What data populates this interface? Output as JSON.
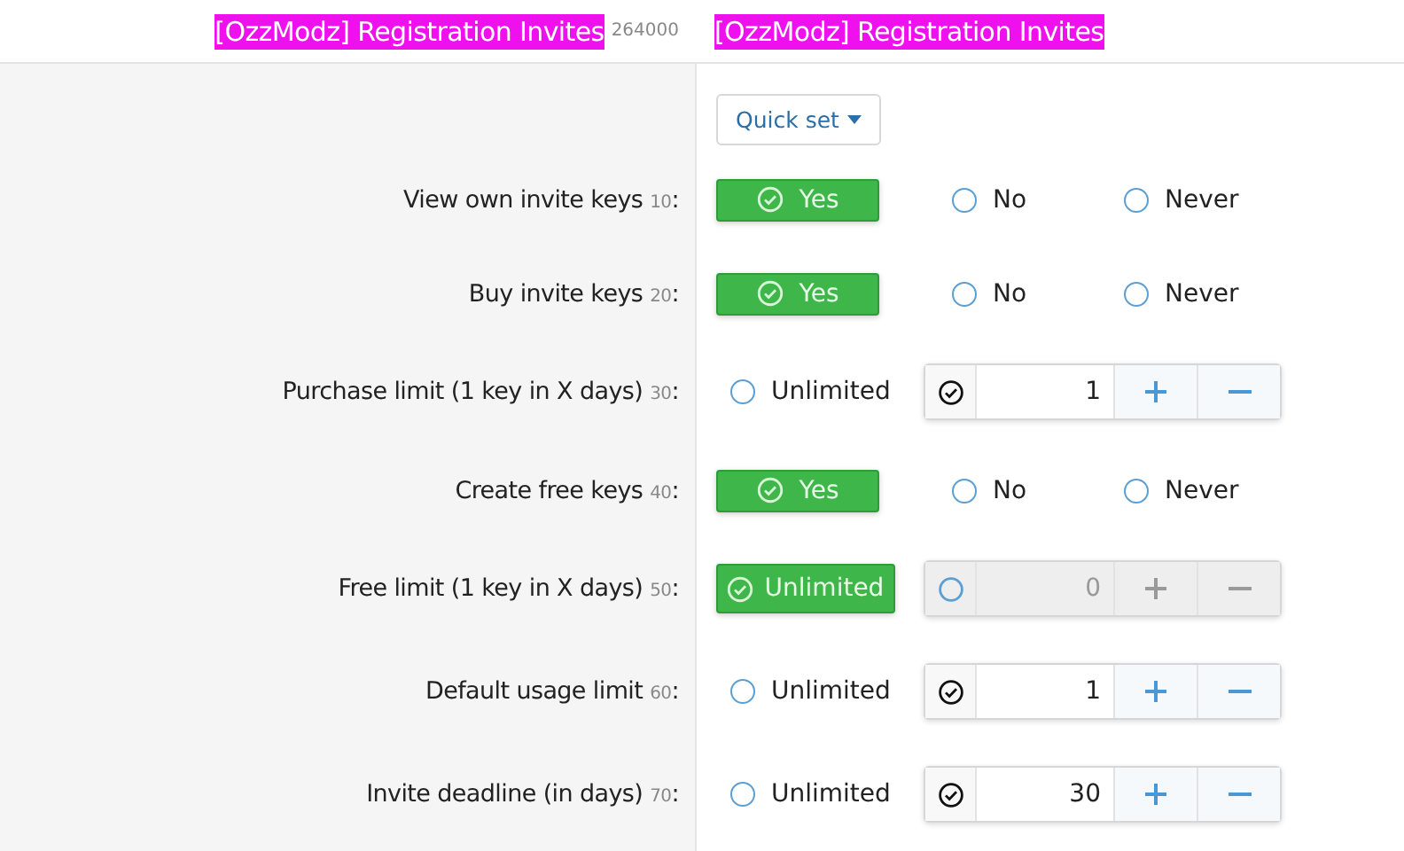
{
  "header": {
    "title": "[OzzModz] Registration Invites",
    "count": "264000",
    "value_title": "[OzzModz] Registration Invites"
  },
  "quick_set": {
    "label": "Quick set"
  },
  "rows": [
    {
      "kind": "tristate",
      "label": "View own invite keys",
      "order": "10",
      "separator": ":",
      "options": [
        {
          "label": "Yes",
          "selected": true
        },
        {
          "label": "No",
          "selected": false
        },
        {
          "label": "Never",
          "selected": false
        }
      ]
    },
    {
      "kind": "tristate",
      "label": "Buy invite keys",
      "order": "20",
      "separator": ":",
      "options": [
        {
          "label": "Yes",
          "selected": true
        },
        {
          "label": "No",
          "selected": false
        },
        {
          "label": "Never",
          "selected": false
        }
      ]
    },
    {
      "kind": "limit",
      "label": "Purchase limit (1 key in X days)",
      "order": "30",
      "separator": ":",
      "unlimited": {
        "label": "Unlimited",
        "selected": false
      },
      "field": {
        "checked": true,
        "value": "1"
      }
    },
    {
      "kind": "tristate",
      "label": "Create free keys",
      "order": "40",
      "separator": ":",
      "options": [
        {
          "label": "Yes",
          "selected": true
        },
        {
          "label": "No",
          "selected": false
        },
        {
          "label": "Never",
          "selected": false
        }
      ]
    },
    {
      "kind": "limit",
      "label": "Free limit (1 key in X days)",
      "order": "50",
      "separator": ":",
      "unlimited": {
        "label": "Unlimited",
        "selected": true
      },
      "field": {
        "checked": false,
        "value": "0"
      }
    },
    {
      "kind": "limit",
      "label": "Default usage limit",
      "order": "60",
      "separator": ":",
      "unlimited": {
        "label": "Unlimited",
        "selected": false
      },
      "field": {
        "checked": true,
        "value": "1"
      }
    },
    {
      "kind": "limit",
      "label": "Invite deadline (in days)",
      "order": "70",
      "separator": ":",
      "unlimited": {
        "label": "Unlimited",
        "selected": false
      },
      "field": {
        "checked": true,
        "value": "30"
      }
    }
  ]
}
